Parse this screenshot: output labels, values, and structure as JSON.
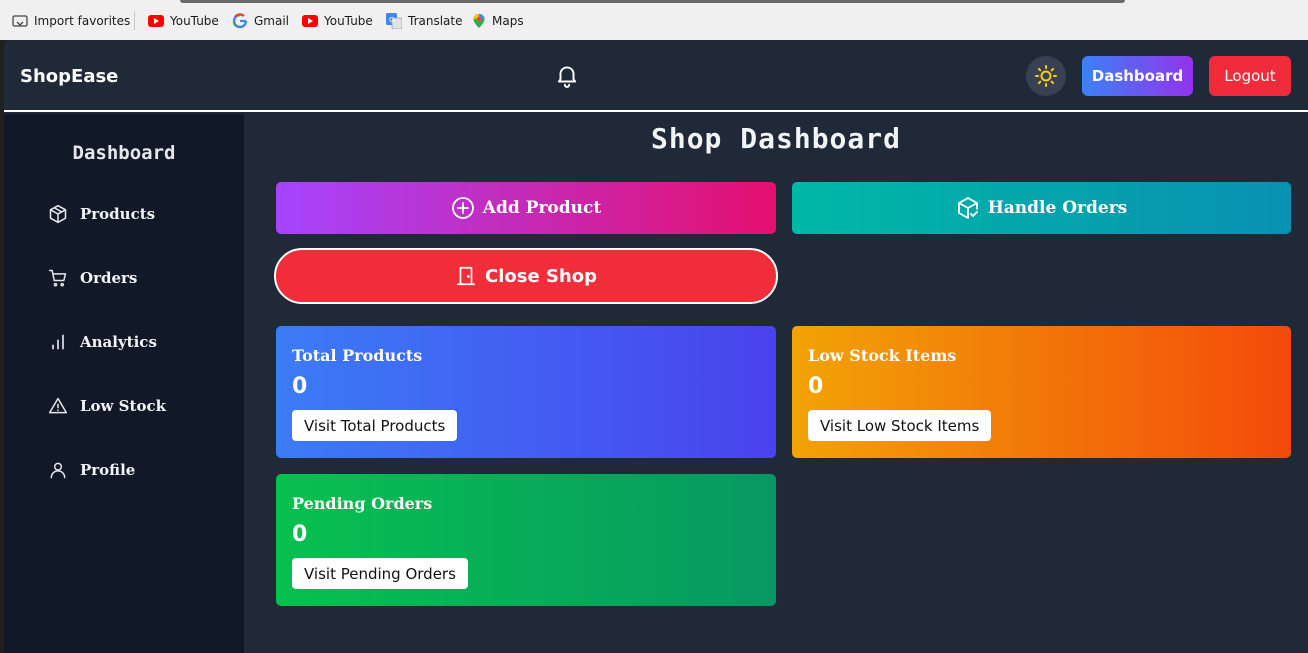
{
  "browser": {
    "bookmarks": [
      {
        "label": "Import favorites",
        "icon": "import-icon"
      },
      {
        "label": "YouTube",
        "icon": "youtube-icon"
      },
      {
        "label": "Gmail",
        "icon": "google-icon"
      },
      {
        "label": "YouTube",
        "icon": "youtube-icon"
      },
      {
        "label": "Translate",
        "icon": "translate-icon"
      },
      {
        "label": "Maps",
        "icon": "maps-icon"
      }
    ]
  },
  "navbar": {
    "brand": "ShopEase",
    "dashboard_label": "Dashboard",
    "logout_label": "Logout",
    "icons": {
      "notifications": "bell-icon",
      "theme": "sun-icon"
    }
  },
  "sidebar": {
    "title": "Dashboard",
    "items": [
      {
        "label": "Products",
        "icon": "box-icon"
      },
      {
        "label": "Orders",
        "icon": "cart-icon"
      },
      {
        "label": "Analytics",
        "icon": "bar-chart-icon"
      },
      {
        "label": "Low Stock",
        "icon": "warning-icon"
      },
      {
        "label": "Profile",
        "icon": "user-icon"
      }
    ]
  },
  "main": {
    "title": "Shop Dashboard",
    "actions": {
      "add_product": "Add Product",
      "handle_orders": "Handle Orders",
      "close_shop": "Close Shop"
    },
    "cards": [
      {
        "title": "Total Products",
        "value": "0",
        "button": "Visit Total Products"
      },
      {
        "title": "Low Stock Items",
        "value": "0",
        "button": "Visit Low Stock Items"
      },
      {
        "title": "Pending Orders",
        "value": "0",
        "button": "Visit Pending Orders"
      }
    ]
  },
  "colors": {
    "app_bg": "#1f2937",
    "sidebar_bg": "#111827",
    "logout": "#ef2b3c",
    "close_shop": "#f22d3a",
    "theme_sun": "#facc15"
  }
}
